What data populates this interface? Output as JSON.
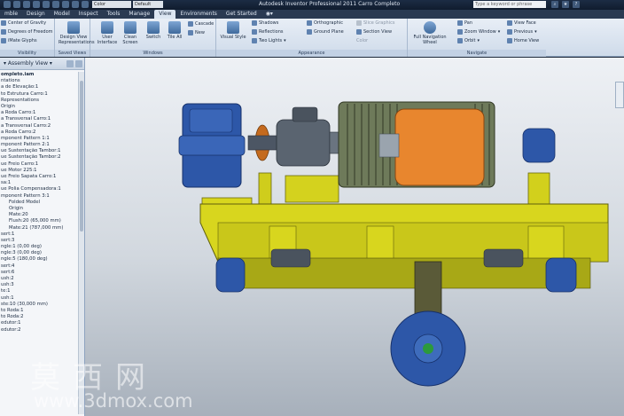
{
  "titlebar": {
    "combo_material": "Color",
    "combo_view": "Default",
    "title": "Autodesk Inventor Professional 2011    Carro Completo",
    "search_placeholder": "Type a keyword or phrase"
  },
  "tabs": [
    "mble",
    "Design",
    "Model",
    "Inspect",
    "Tools",
    "Manage",
    "View",
    "Environments",
    "Get Started"
  ],
  "active_tab": "View",
  "ribbon": {
    "visibility": {
      "items": [
        "Center of Gravity",
        "Degrees of Freedom",
        "iMate Glyphs"
      ],
      "title": "Visibility"
    },
    "saved_views": {
      "label": "Design View Representations",
      "title": "Saved Views"
    },
    "windows": {
      "user_interface": "User Interface",
      "clean_screen": "Clean Screen",
      "switch": "Switch",
      "tile_all": "Tile All",
      "cascade": "Cascade",
      "new": "New",
      "title": "Windows"
    },
    "appearance": {
      "visual_style": "Visual Style",
      "shadows": "Shadows",
      "reflections": "Reflections",
      "two_lights": "Two Lights",
      "orthographic": "Orthographic",
      "ground_plane": "Ground Plane",
      "slice_graphics": "Slice Graphics",
      "section_view": "Section View",
      "color": "Color",
      "title": "Appearance"
    },
    "navigate": {
      "full_navigation_wheel": "Full Navigation Wheel",
      "pan": "Pan",
      "zoom_window": "Zoom Window",
      "orbit": "Orbit",
      "view_face": "View Face",
      "previous": "Previous",
      "home_view": "Home View",
      "title": "Navigate"
    }
  },
  "browser": {
    "header": "Assembly View",
    "nodes": [
      "ompleto.iam",
      "ntations",
      "a de Elevação:1",
      "to Estrutura Carro:1",
      "Representations",
      "Origin",
      "a Roda Carro:1",
      "a Transversal Carro:1",
      "a Transversal Carro:2",
      "a Roda Carro:2",
      "mponent Pattern 1:1",
      "mponent Pattern 2:1",
      "ue Sustentação Tambor:1",
      "ue Sustentação Tambor:2",
      "ue Freio Carro:1",
      "ue Motor 225:1",
      "ue Freio Sapata Carro:1",
      "sa:1",
      "ue Polia Compensadora:1",
      "mponent Pattern 3:1",
      "Folded Model",
      "Origin",
      "Mate:20",
      "Flush:20 (65,000 mm)",
      "Mate:21 (787,000 mm)",
      "sert:1",
      "sert:3",
      "ngle:1 (0,00 deg)",
      "ngle:3 (0,00 deg)",
      "ngle:5 (180,00 deg)",
      "sert:4",
      "sert:6",
      "ush:2",
      "ush:3",
      "te:1",
      "ush:1",
      "ste:10 (30,000 mm)",
      "to Roda:1",
      "to Roda:2",
      "edutor:1",
      "edutor:2"
    ]
  },
  "watermark": {
    "chinese": "莫西网",
    "url": "www.3dmox.com"
  },
  "colors": {
    "yellow_frame": "#d8d61e",
    "blue_parts": "#2d57a8",
    "orange_part": "#e8862e",
    "motor_gray": "#5a6470",
    "drum_green": "#6e7a5a"
  }
}
